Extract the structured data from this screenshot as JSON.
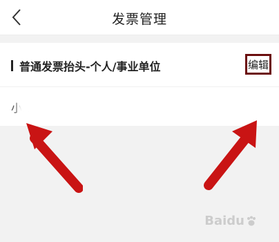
{
  "header": {
    "title": "发票管理"
  },
  "invoice_section": {
    "title": "普通发票抬头-个人/事业单位",
    "entry": {
      "name": "小X",
      "edit_label": "编辑"
    }
  },
  "watermark": {
    "text": "Baidu"
  },
  "icons": {
    "back": "chevron-left-icon",
    "arrows": "red-arrow-icon",
    "watermark": "paw-icon"
  },
  "colors": {
    "accent": "#d81e1e",
    "highlight_border": "#6b0e0e"
  }
}
